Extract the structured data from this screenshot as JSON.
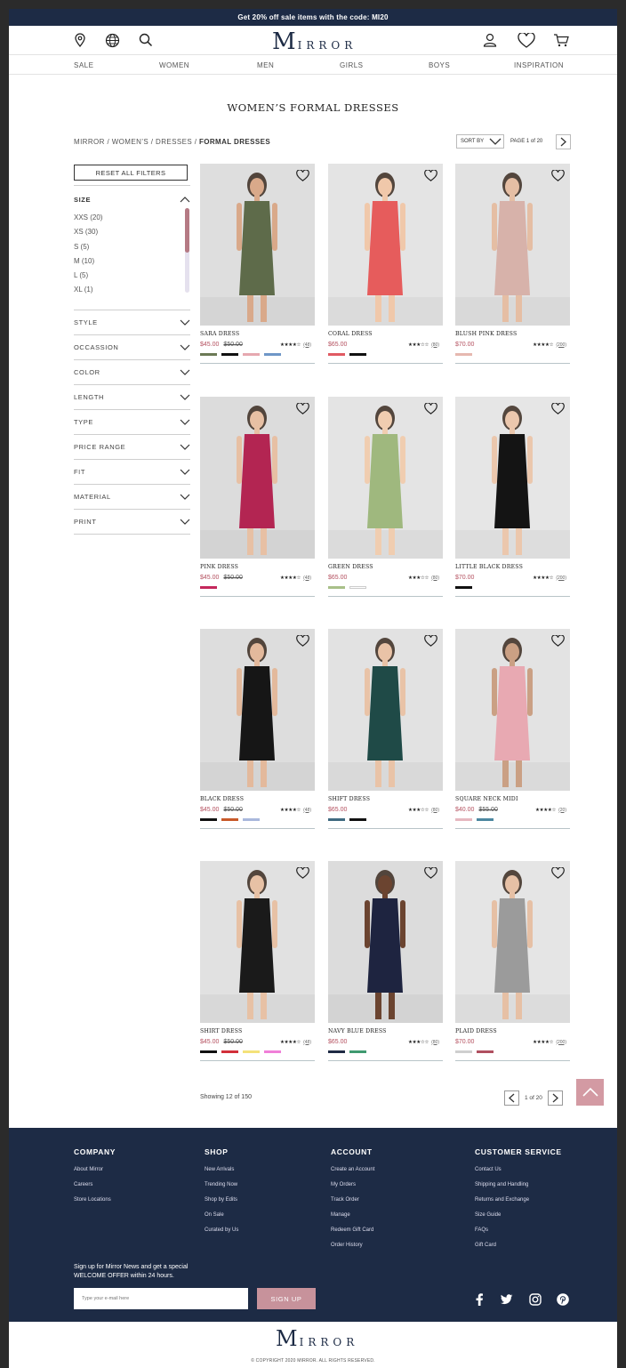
{
  "promo": "Get 20% off sale items with the code: MI20",
  "logo": {
    "initial": "M",
    "rest": "IRROR"
  },
  "nav": [
    "SALE",
    "WOMEN",
    "MEN",
    "GIRLS",
    "BOYS",
    "INSPIRATION"
  ],
  "page_title": "WOMEN’S FORMAL DRESSES",
  "breadcrumb": {
    "trail": "MIRROR  /  WOMEN’S  /  DRESSES  /",
    "current": "FORMAL DRESSES"
  },
  "sort": {
    "label": "SORT BY",
    "page": "PAGE 1 of 20"
  },
  "filters": {
    "reset": "RESET ALL FILTERS",
    "size_heading": "SIZE",
    "size_options": [
      "XXS (20)",
      "XS (30)",
      "S (5)",
      "M (10)",
      "L (5)",
      "XL (1)"
    ],
    "sections": [
      "STYLE",
      "OCCASSION",
      "COLOR",
      "LENGTH",
      "TYPE",
      "PRICE RANGE",
      "FIT",
      "MATERIAL",
      "PRINT"
    ]
  },
  "products": [
    {
      "name": "SARA DRESS",
      "price": "$45.00",
      "old_price": "$50.00",
      "stars": "★★★★☆",
      "count": "(48)",
      "swatches": [
        "#6b7a55",
        "#111111",
        "#e6a8b0",
        "#6f97c7"
      ],
      "dress_color": "#5e6b4a",
      "skin": "#d9a98a",
      "bg": "#dedede"
    },
    {
      "name": "CORAL DRESS",
      "price": "$65.00",
      "old_price": "",
      "stars": "★★★☆☆",
      "count": "(80)",
      "swatches": [
        "#e05a62",
        "#111111"
      ],
      "dress_color": "#e65c5c",
      "skin": "#f0c8aa",
      "bg": "#e4e4e4"
    },
    {
      "name": "BLUSH PINK DRESS",
      "price": "$70.00",
      "old_price": "",
      "stars": "★★★★☆",
      "count": "(200)",
      "swatches": [
        "#e6b8b0"
      ],
      "dress_color": "#d7b2aa",
      "skin": "#e5bea4",
      "bg": "#e2e2e2"
    },
    {
      "name": "PINK DRESS",
      "price": "$45.00",
      "old_price": "$50.00",
      "stars": "★★★★☆",
      "count": "(48)",
      "swatches": [
        "#c4285c"
      ],
      "dress_color": "#b32552",
      "skin": "#e7c0a4",
      "bg": "#dcdcdc"
    },
    {
      "name": "GREEN DRESS",
      "price": "$65.00",
      "old_price": "",
      "stars": "★★★☆☆",
      "count": "(80)",
      "swatches": [
        "#a8c089",
        "#ffffff"
      ],
      "dress_color": "#9fb87e",
      "skin": "#f0cdb0",
      "bg": "#e4e4e4"
    },
    {
      "name": "LITTLE BLACK DRESS",
      "price": "$70.00",
      "old_price": "",
      "stars": "★★★★☆",
      "count": "(200)",
      "swatches": [
        "#111111"
      ],
      "dress_color": "#141414",
      "skin": "#ebc7ad",
      "bg": "#e6e6e6"
    },
    {
      "name": "BLACK DRESS",
      "price": "$45.00",
      "old_price": "$50.00",
      "stars": "★★★★☆",
      "count": "(48)",
      "swatches": [
        "#111111",
        "#c85a2a",
        "#a9b8dc"
      ],
      "dress_color": "#161616",
      "skin": "#e3b99c",
      "bg": "#dddddd"
    },
    {
      "name": "SHIFT DRESS",
      "price": "$65.00",
      "old_price": "",
      "stars": "★★★☆☆",
      "count": "(80)",
      "swatches": [
        "#406a80",
        "#111111"
      ],
      "dress_color": "#1f4a47",
      "skin": "#e9c3a7",
      "bg": "#e2e2e2"
    },
    {
      "name": "SQUARE NECK MIDI",
      "price": "$40.00",
      "old_price": "$55.00",
      "stars": "★★★★☆",
      "count": "(20)",
      "swatches": [
        "#e6b8c0",
        "#4c87a0"
      ],
      "dress_color": "#e8a9b2",
      "skin": "#caa084",
      "bg": "#e3e3e3"
    },
    {
      "name": "SHIRT DRESS",
      "price": "$45.00",
      "old_price": "$50.00",
      "stars": "★★★★☆",
      "count": "(48)",
      "swatches": [
        "#111111",
        "#d2303a",
        "#f4e27a",
        "#f07fd8"
      ],
      "dress_color": "#1a1a1a",
      "skin": "#e7c1a5",
      "bg": "#e1e1e1"
    },
    {
      "name": "NAVY BLUE DRESS",
      "price": "$65.00",
      "old_price": "",
      "stars": "★★★☆☆",
      "count": "(80)",
      "swatches": [
        "#1f2a44",
        "#3f9a70"
      ],
      "dress_color": "#1e2440",
      "skin": "#6b4430",
      "bg": "#dcdcdc"
    },
    {
      "name": "PLAID DRESS",
      "price": "$70.00",
      "old_price": "",
      "stars": "★★★★☆",
      "count": "(200)",
      "swatches": [
        "#cfcfcf",
        "#b05060"
      ],
      "dress_color": "#9b9b9b",
      "skin": "#e6c0a5",
      "bg": "#e5e5e5"
    }
  ],
  "showing": "Showing 12 of 150",
  "pager": "1 of 20",
  "footer": {
    "columns": [
      {
        "heading": "COMPANY",
        "links": [
          "About Mirror",
          "Careers",
          "Store Locations"
        ]
      },
      {
        "heading": "SHOP",
        "links": [
          "New Arrivals",
          "Trending Now",
          "Shop by Edits",
          "On Sale",
          "Curated by Us"
        ]
      },
      {
        "heading": "ACCOUNT",
        "links": [
          "Create an Account",
          "My Orders",
          "Track Order",
          "Manage",
          "Redeem Gift Card",
          "Order History"
        ]
      },
      {
        "heading": "CUSTOMER SERVICE",
        "links": [
          "Contact Us",
          "Shipping and Handling",
          "Returns and Exchange",
          "Size Guide",
          "FAQs",
          "Gift Card"
        ]
      }
    ],
    "signup_line1": "Sign up for Mirror News and get a special",
    "signup_line2": "WELCOME OFFER within 24 hours.",
    "email_placeholder": "Type your e-mail here",
    "signup_button": "SIGN UP"
  },
  "copyright": "© COPYRIGHT 2020 MIRROR. ALL RIGHTS RESERVED.",
  "colors": {
    "navy": "#1d2b45",
    "accent_pink": "#b4505f",
    "button_pink": "#c7929b"
  }
}
